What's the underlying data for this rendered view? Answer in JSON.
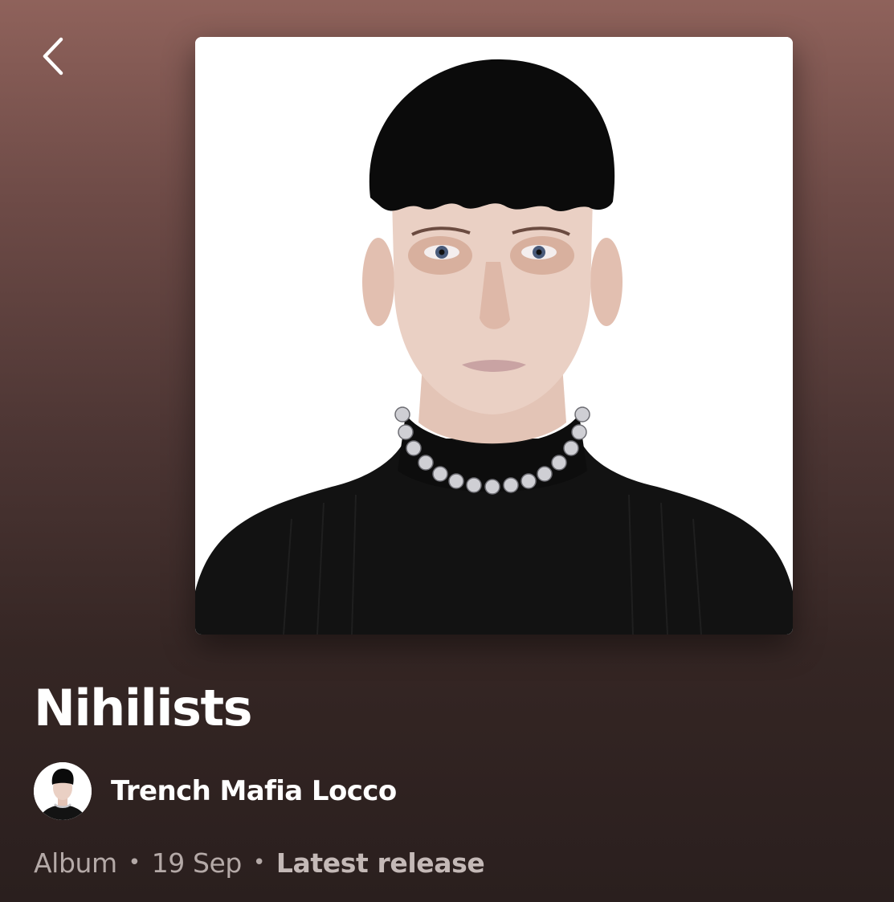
{
  "header": {
    "back_icon": "chevron-left-icon"
  },
  "album": {
    "title": "Nihilists",
    "cover_description_icon": "album-cover-portrait",
    "artist": {
      "name": "Trench Mafia Locco",
      "avatar_icon": "artist-avatar"
    },
    "meta": {
      "type": "Album",
      "date": "19 Sep",
      "separator": "•",
      "badge": "Latest release"
    }
  },
  "colors": {
    "background_top": "#8f625b",
    "background_bottom": "#2a1f1e",
    "primary_text": "#ffffff",
    "secondary_text": "#b4a9a7"
  }
}
